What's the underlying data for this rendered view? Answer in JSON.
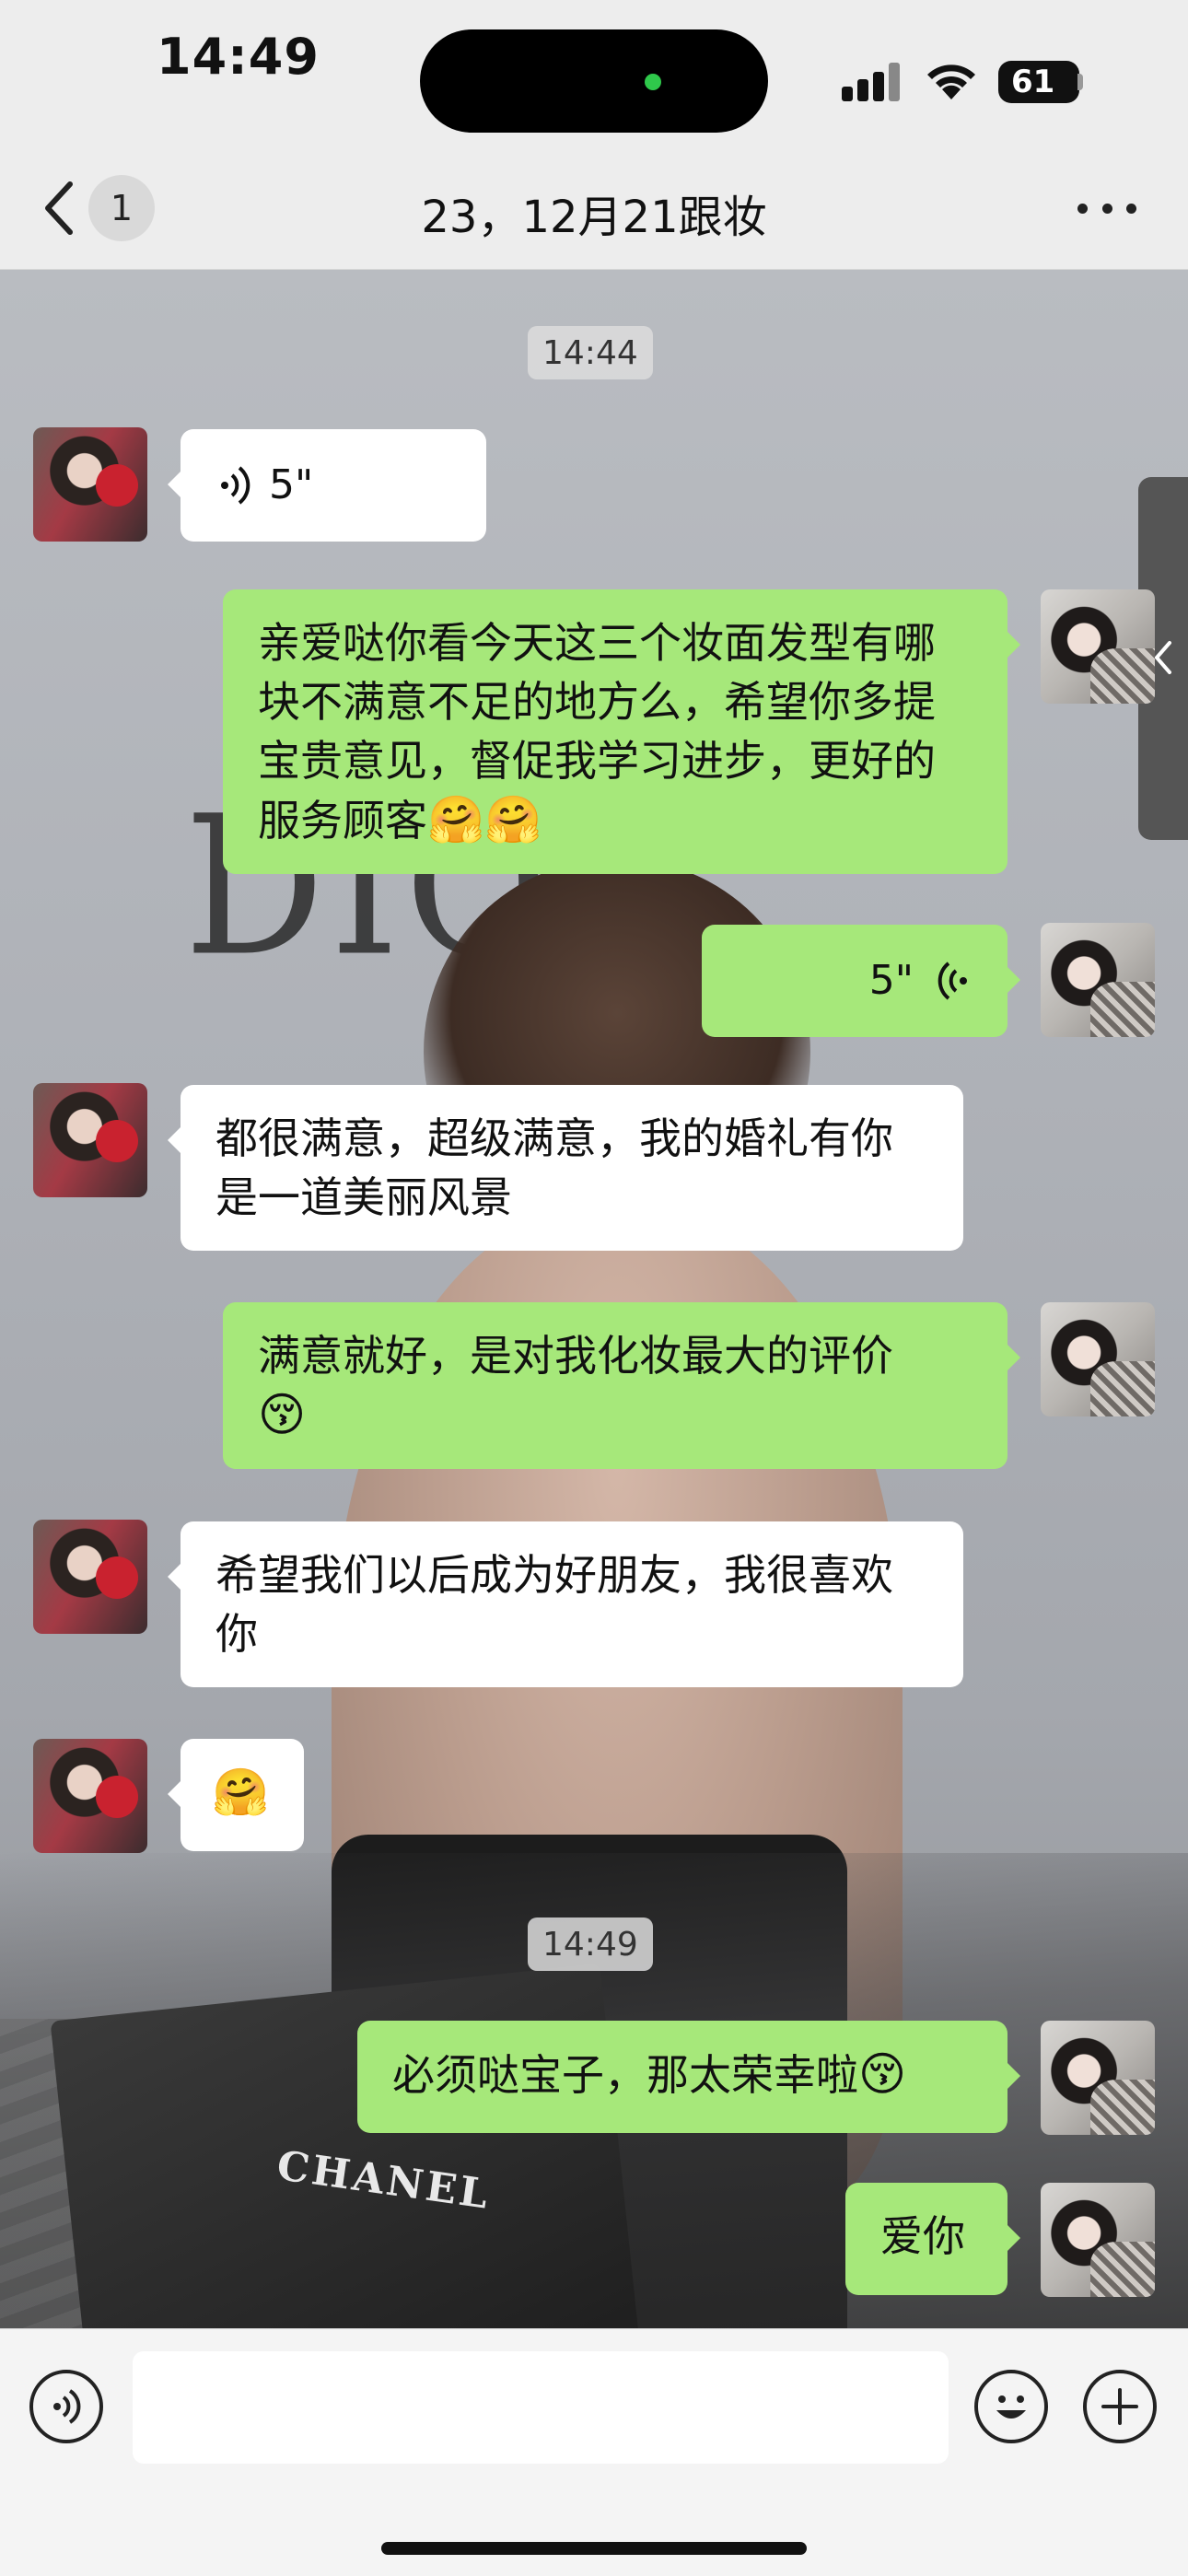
{
  "status_bar": {
    "time": "14:49",
    "battery": "61"
  },
  "nav": {
    "back_badge": "1",
    "title": "23，12月21跟妆"
  },
  "messages": [
    {
      "type": "timestamp",
      "text": "14:44"
    },
    {
      "type": "voice",
      "side": "in",
      "duration": "5\""
    },
    {
      "type": "text",
      "side": "out",
      "text": "亲爱哒你看今天这三个妆面发型有哪块不满意不足的地方么，希望你多提宝贵意见，督促我学习进步，更好的服务顾客",
      "emojis": [
        "🤗",
        "🤗"
      ]
    },
    {
      "type": "voice",
      "side": "out",
      "duration": "5\""
    },
    {
      "type": "text",
      "side": "in",
      "text": "都很满意，超级满意，我的婚礼有你是一道美丽风景"
    },
    {
      "type": "text",
      "side": "out",
      "text": "满意就好，是对我化妆最大的评价",
      "emojis": [
        "😚"
      ]
    },
    {
      "type": "text",
      "side": "in",
      "text": "希望我们以后成为好朋友，我很喜欢你"
    },
    {
      "type": "sticker",
      "side": "in",
      "emoji": "🤗"
    },
    {
      "type": "timestamp",
      "text": "14:49"
    },
    {
      "type": "text",
      "side": "out",
      "text": "必须哒宝子，那太荣幸啦",
      "emojis": [
        "😚"
      ]
    },
    {
      "type": "text",
      "side": "out",
      "text": "爱你"
    }
  ],
  "input": {
    "placeholder": ""
  },
  "colors": {
    "bubble_out": "#a6e87a",
    "bubble_in": "#ffffff",
    "nav_bg": "#ededed"
  },
  "icons": [
    "back-chevron-icon",
    "more-icon",
    "voice-wave-icon",
    "voice-input-icon",
    "emoji-icon",
    "plus-icon",
    "expand-chevron-icon"
  ]
}
